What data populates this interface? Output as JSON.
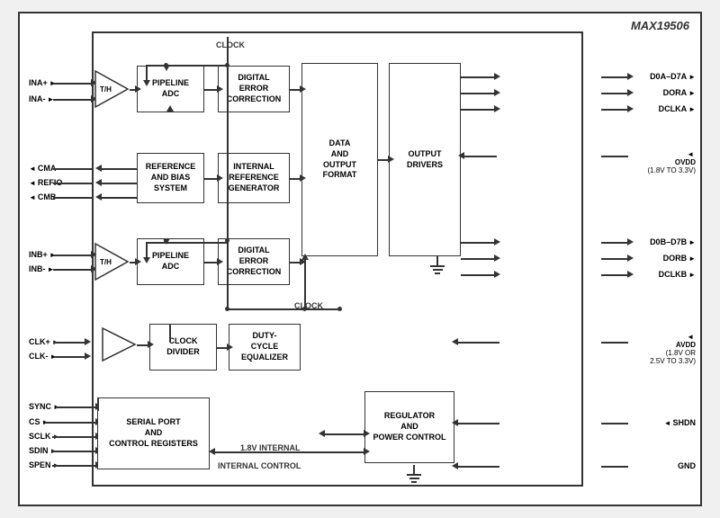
{
  "chip": {
    "name": "MAX19506",
    "blocks": {
      "th_a": "T/H",
      "pipeline_adc_a": "PIPELINE\nADC",
      "digital_error_a": "DIGITAL\nERROR\nCORRECTION",
      "reference_bias": "REFERENCE\nAND BIAS\nSYSTEM",
      "internal_ref": "INTERNAL\nREFERENCE\nGENERATOR",
      "data_output_format": "DATA\nAND\nOUTPUT\nFORMAT",
      "output_drivers": "OUTPUT\nDRIVERS",
      "th_b": "T/H",
      "pipeline_adc_b": "PIPELINE\nADC",
      "digital_error_b": "DIGITAL\nERROR\nCORRECTION",
      "clock_divider": "CLOCK\nDIVIDER",
      "duty_cycle": "DUTY-\nCYCLE\nEQUALIZER",
      "serial_port": "SERIAL PORT\nAND\nCONTROL REGISTERS",
      "regulator": "REGULATOR\nAND\nPOWER CONTROL"
    },
    "signals_left": [
      "INA+",
      "INA-",
      "CMA",
      "REFIO",
      "CMB",
      "INB+",
      "INB-",
      "CLK+",
      "CLK-",
      "SYNC",
      "CS",
      "SCLK",
      "SDIN",
      "SPEN"
    ],
    "signals_right": [
      "D0A-D7A",
      "DORA",
      "DCLKA",
      "OVDD\n(1.8V TO 3.3V)",
      "D0B-D7B",
      "DORB",
      "DCLKB",
      "AVDD\n(1.8V OR\n2.5V TO 3.3V)",
      "SHDN",
      "GND"
    ],
    "labels": {
      "clock_top": "CLOCK",
      "clock_mid": "CLOCK",
      "internal_18v": "1.8V INTERNAL",
      "internal_ctrl": "INTERNAL CONTROL"
    }
  }
}
